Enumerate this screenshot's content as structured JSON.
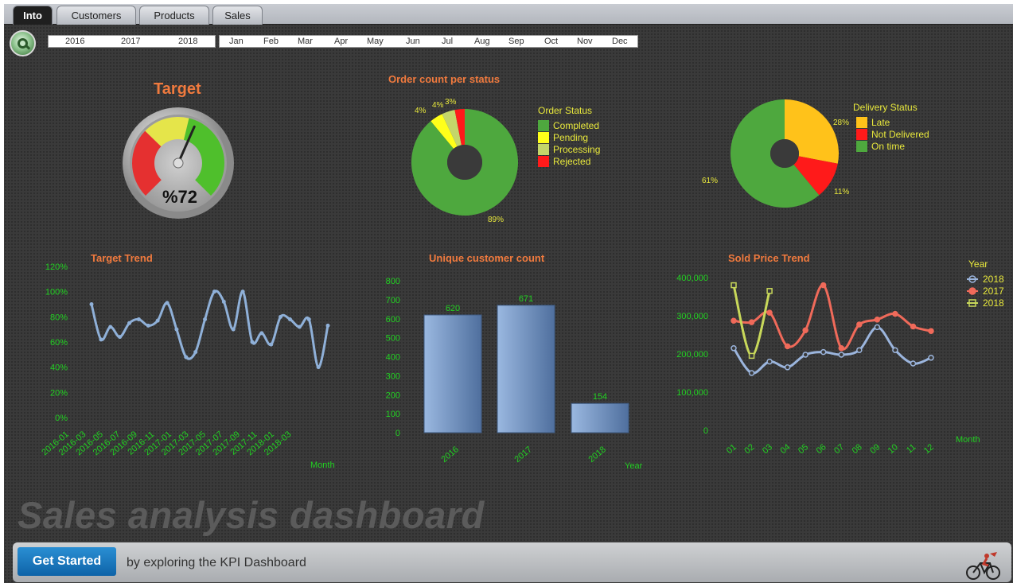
{
  "tabs": [
    {
      "label": "Into",
      "active": true
    },
    {
      "label": "Customers"
    },
    {
      "label": "Products"
    },
    {
      "label": "Sales"
    }
  ],
  "filters": {
    "years": [
      "2016",
      "2017",
      "2018"
    ],
    "months": [
      "Jan",
      "Feb",
      "Mar",
      "Apr",
      "May",
      "Jun",
      "Jul",
      "Aug",
      "Sep",
      "Oct",
      "Nov",
      "Dec"
    ]
  },
  "icons": {
    "logo": "qlik-logo-icon",
    "bottom_right": "cyclist-icon"
  },
  "colors": {
    "title_orange": "#f07a3e",
    "axis_green": "#22d022",
    "label_yellow": "#e8e83c",
    "bar_blue": "#7ea0cc"
  },
  "gauge": {
    "title": "Target",
    "value": 72,
    "display": "%72"
  },
  "order_status": {
    "title": "Order count per status",
    "legend_title": "Order Status",
    "slices": [
      {
        "name": "Completed",
        "value": 89,
        "color": "#4ea83e"
      },
      {
        "name": "Pending",
        "value": 4,
        "color": "#ffff1a"
      },
      {
        "name": "Processing",
        "value": 4,
        "color": "#c4d66a"
      },
      {
        "name": "Rejected",
        "value": 3,
        "color": "#ff1a1a"
      }
    ],
    "labels": [
      "4%",
      "4%",
      "3%",
      "89%"
    ]
  },
  "delivery_status": {
    "legend_title": "Delivery Status",
    "slices": [
      {
        "name": "Late",
        "value": 28,
        "color": "#ffc21a"
      },
      {
        "name": "Not Delivered",
        "value": 11,
        "color": "#ff1a1a"
      },
      {
        "name": "On time",
        "value": 61,
        "color": "#4ea83e"
      }
    ],
    "labels": [
      "28%",
      "11%",
      "61%"
    ]
  },
  "chart_data": [
    {
      "type": "line",
      "title": "Target Trend",
      "xlabel": "Month",
      "ylabel": "",
      "x": [
        "2016-01",
        "2016-03",
        "2016-05",
        "2016-07",
        "2016-09",
        "2016-11",
        "2017-01",
        "2017-03",
        "2017-05",
        "2017-07",
        "2017-09",
        "2017-11",
        "2018-01",
        "2018-03"
      ],
      "yticks": [
        "0%",
        "20%",
        "40%",
        "60%",
        "80%",
        "100%",
        "120%"
      ],
      "ylim": [
        0,
        120
      ],
      "values": [
        90,
        62,
        72,
        64,
        75,
        78,
        73,
        77,
        91,
        70,
        48,
        52,
        78,
        100,
        92,
        70,
        100,
        60,
        67,
        58,
        80,
        78,
        72,
        78,
        40,
        73
      ]
    },
    {
      "type": "bar",
      "title": "Unique customer count",
      "xlabel": "Year",
      "ylabel": "",
      "categories": [
        "2016",
        "2017",
        "2018"
      ],
      "values": [
        620,
        671,
        154
      ],
      "ylim": [
        0,
        800
      ],
      "yticks": [
        "0",
        "100",
        "200",
        "300",
        "400",
        "500",
        "600",
        "700",
        "800"
      ]
    },
    {
      "type": "line",
      "title": "Sold Price Trend",
      "xlabel": "Month",
      "ylabel": "",
      "legend_title": "Year",
      "x": [
        "01",
        "02",
        "03",
        "04",
        "05",
        "06",
        "07",
        "08",
        "09",
        "10",
        "11",
        "12"
      ],
      "yticks": [
        "0",
        "100,000",
        "200,000",
        "300,000",
        "400,000"
      ],
      "ylim": [
        0,
        400000
      ],
      "series": [
        {
          "name": "2018",
          "color": "#9bb5dd",
          "values": [
            215000,
            150000,
            180000,
            165000,
            198000,
            205000,
            198000,
            210000,
            270000,
            210000,
            175000,
            190000
          ]
        },
        {
          "name": "2017",
          "color": "#f06a5a",
          "values": [
            287000,
            283000,
            308000,
            220000,
            262000,
            380000,
            215000,
            277000,
            290000,
            305000,
            272000,
            260000
          ]
        },
        {
          "name": "2018",
          "color": "#c8d85a",
          "values": [
            380000,
            195000,
            365000
          ]
        }
      ]
    }
  ],
  "banner": {
    "title": "Sales analysis dashboard",
    "button": "Get Started",
    "tagline": "by exploring the KPI Dashboard"
  }
}
